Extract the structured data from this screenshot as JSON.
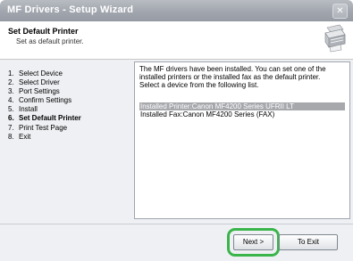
{
  "window": {
    "title": "MF Drivers - Setup Wizard",
    "close_glyph": "✕"
  },
  "header": {
    "title": "Set Default Printer",
    "subtitle": "Set as default printer.",
    "icon": "printer-icon"
  },
  "steps": [
    {
      "num": "1.",
      "label": "Select Device"
    },
    {
      "num": "2.",
      "label": "Select Driver"
    },
    {
      "num": "3.",
      "label": "Port Settings"
    },
    {
      "num": "4.",
      "label": "Confirm Settings"
    },
    {
      "num": "5.",
      "label": "Install"
    },
    {
      "num": "6.",
      "label": "Set Default Printer",
      "current": true
    },
    {
      "num": "7.",
      "label": "Print Test Page"
    },
    {
      "num": "8.",
      "label": "Exit"
    }
  ],
  "content": {
    "line1": "The MF drivers have been installed. You can set one of the",
    "line2": "installed printers or the installed fax as the default printer.",
    "line3": "Select a device from the following list.",
    "devices": [
      {
        "label": "Installed Printer:Canon MF4200 Series UFRII LT",
        "selected": true
      },
      {
        "label": "Installed Fax:Canon MF4200 Series (FAX)",
        "selected": false
      }
    ]
  },
  "buttons": {
    "next": "Next >",
    "exit": "To Exit"
  },
  "colors": {
    "highlight": "#39b54a",
    "selection": "#a6a8ac",
    "titlebar": "#a3a8b0"
  }
}
